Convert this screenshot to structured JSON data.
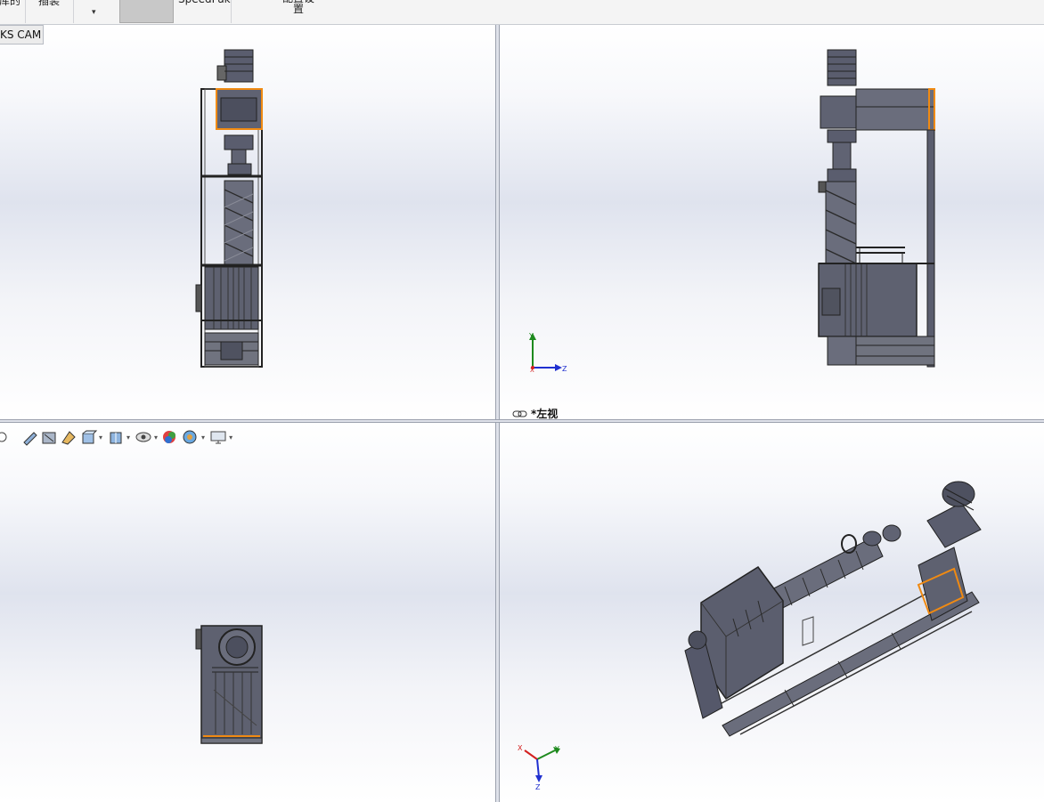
{
  "ribbon": {
    "items": [
      "库的",
      "插装",
      "",
      "SpeedPak",
      "配置设置"
    ],
    "dropdown_glyph": "▾"
  },
  "cam_tab": {
    "label": "KS CAM"
  },
  "viewports": {
    "top_left": {
      "name": "front-view"
    },
    "top_right": {
      "name": "left-view",
      "label": "*左视"
    },
    "bottom_left": {
      "name": "top-view"
    },
    "bottom_right": {
      "name": "isometric-view"
    }
  },
  "triad": {
    "x": "X",
    "y": "Y",
    "z": "Z"
  },
  "heads_up_toolbar": {
    "icons": [
      "zoom-to-fit-icon",
      "zoom-area-icon",
      "previous-view-icon",
      "section-view-icon",
      "view-orientation-icon",
      "display-style-icon",
      "hide-show-icon",
      "edit-appearance-icon",
      "apply-scene-icon",
      "view-settings-icon"
    ]
  },
  "colors": {
    "accent": "#f08a12",
    "model": "#55586a",
    "axis_x": "#d32020",
    "axis_y": "#1e8a1e",
    "axis_z": "#2030d0"
  }
}
